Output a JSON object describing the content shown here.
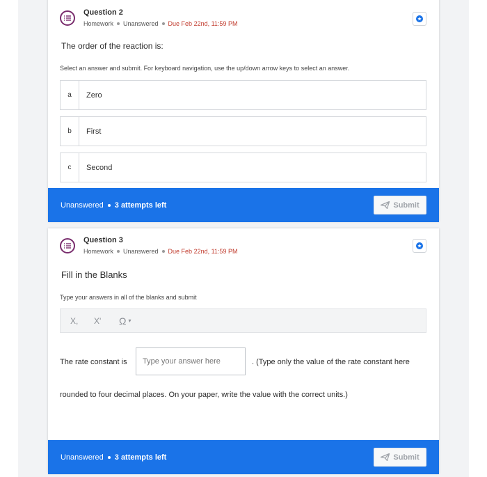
{
  "questions": [
    {
      "title": "Question 2",
      "type": "Homework",
      "status": "Unanswered",
      "due": "Due Feb 22nd, 11:59 PM",
      "prompt": "The order of the reaction is:",
      "instructions": "Select an answer and submit. For keyboard navigation, use the up/down arrow keys to select an answer.",
      "choices": [
        {
          "letter": "a",
          "text": "Zero"
        },
        {
          "letter": "b",
          "text": "First"
        },
        {
          "letter": "c",
          "text": "Second"
        }
      ],
      "footer_status": "Unanswered",
      "attempts": "3 attempts left",
      "submit_label": "Submit"
    },
    {
      "title": "Question 3",
      "type": "Homework",
      "status": "Unanswered",
      "due": "Due Feb 22nd, 11:59 PM",
      "prompt": "Fill in the Blanks",
      "instructions": "Type your answers in all of the blanks and submit",
      "toolbar": {
        "subscript": "X,",
        "superscript": "X'",
        "special_chars": "Ω"
      },
      "fill_before": "The rate constant is",
      "blank_placeholder": "Type your answer here",
      "fill_after": ". (Type only the value of the rate constant here",
      "fill_continued": "rounded to four decimal places. On your paper, write the value with the correct units.)",
      "footer_status": "Unanswered",
      "attempts": "3 attempts left",
      "submit_label": "Submit"
    }
  ],
  "colors": {
    "accent": "#1a73e8",
    "due": "#c0392b",
    "icon": "#7a2e6e"
  }
}
